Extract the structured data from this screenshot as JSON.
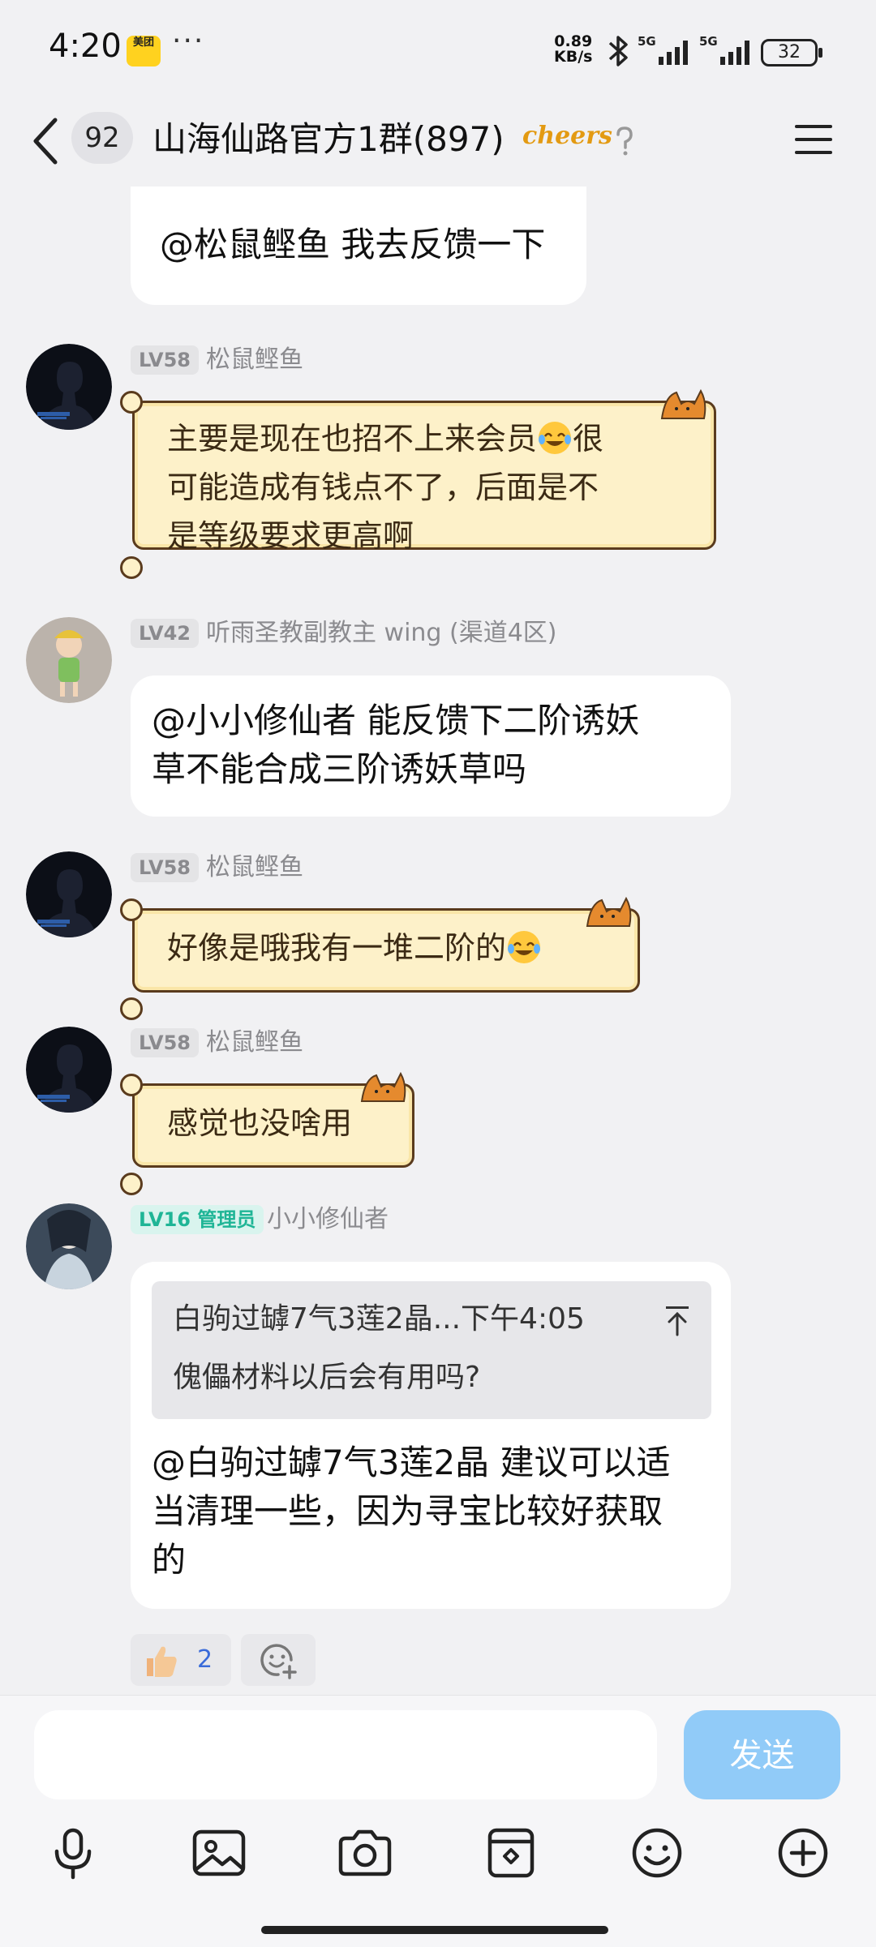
{
  "status_bar": {
    "time": "4:20",
    "app_badge": "美团",
    "dots": "···",
    "net_speed_value": "0.89",
    "net_speed_unit": "KB/s",
    "sig1": "5G",
    "sig2": "5G",
    "battery": "32"
  },
  "header": {
    "unread_count": "92",
    "title": "山海仙路官方1群(897)",
    "badge": "cheers"
  },
  "messages": {
    "m0": {
      "text": "@松鼠鲣鱼 我去反馈一下"
    },
    "m1": {
      "level": "LV58",
      "nick": "松鼠鲣鱼",
      "line1": "主要是现在也招不上来会员",
      "line1b": "很",
      "line2": "可能造成有钱点不了，后面是不",
      "line3": "是等级要求更高啊"
    },
    "m2": {
      "level": "LV42",
      "nick": "听雨圣教副教主 wing (渠道4区)",
      "line1": "@小小修仙者 能反馈下二阶诱妖",
      "line2": "草不能合成三阶诱妖草吗"
    },
    "m3": {
      "level": "LV58",
      "nick": "松鼠鲣鱼",
      "text": "好像是哦我有一堆二阶的"
    },
    "m4": {
      "level": "LV58",
      "nick": "松鼠鲣鱼",
      "text": "感觉也没啥用"
    },
    "m5": {
      "level": "LV16 管理员",
      "nick": "小小修仙者",
      "quote_header": "白驹过罅7气3莲2晶...下午4:05",
      "quote_text": "傀儡材料以后会有用吗?",
      "line1": "@白驹过罅7气3莲2晶 建议可以适",
      "line2": "当清理一些，因为寻宝比较好获取",
      "line3": "的",
      "like_count": "2"
    }
  },
  "input": {
    "placeholder": "",
    "send_label": "发送"
  },
  "colors": {
    "accent_send": "#91cbf8",
    "admin_badge": "#1fb596",
    "scroll_bubble": "#fdf1c9"
  },
  "icons": [
    "back-icon",
    "help-icon",
    "menu-icon",
    "microphone-icon",
    "image-icon",
    "camera-icon",
    "sticker-icon",
    "emoji-icon",
    "plus-icon",
    "thumbs-up-icon",
    "add-reaction-icon",
    "scroll-top-icon"
  ]
}
